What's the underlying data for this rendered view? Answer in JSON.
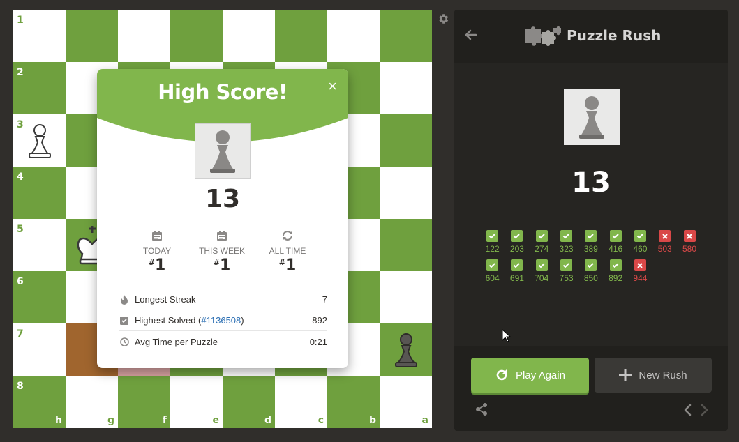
{
  "board": {
    "ranks": [
      "1",
      "2",
      "3",
      "4",
      "5",
      "6",
      "7",
      "8"
    ],
    "files": [
      "h",
      "g",
      "f",
      "e",
      "d",
      "c",
      "b",
      "a"
    ]
  },
  "modal": {
    "title": "High Score!",
    "close": "×",
    "score": "13",
    "ranks": [
      {
        "label": "TODAY",
        "prefix": "#",
        "value": "1"
      },
      {
        "label": "THIS WEEK",
        "prefix": "#",
        "value": "1"
      },
      {
        "label": "ALL TIME",
        "prefix": "#",
        "value": "1"
      }
    ],
    "stats": {
      "streak_label": "Longest Streak",
      "streak_value": "7",
      "highest_label": "Highest Solved (",
      "highest_link": "#1136508",
      "highest_close": ")",
      "highest_value": "892",
      "avg_label": "Avg Time per Puzzle",
      "avg_value": "0:21"
    }
  },
  "sidebar": {
    "title": "Puzzle Rush",
    "score": "13",
    "results_row1": [
      {
        "num": "122",
        "ok": true
      },
      {
        "num": "203",
        "ok": true
      },
      {
        "num": "274",
        "ok": true
      },
      {
        "num": "323",
        "ok": true
      },
      {
        "num": "389",
        "ok": true
      },
      {
        "num": "416",
        "ok": true
      },
      {
        "num": "460",
        "ok": true
      },
      {
        "num": "503",
        "ok": false
      },
      {
        "num": "580",
        "ok": false
      }
    ],
    "results_row2": [
      {
        "num": "604",
        "ok": true
      },
      {
        "num": "691",
        "ok": true
      },
      {
        "num": "704",
        "ok": true
      },
      {
        "num": "753",
        "ok": true
      },
      {
        "num": "850",
        "ok": true
      },
      {
        "num": "892",
        "ok": true
      },
      {
        "num": "944",
        "ok": false
      }
    ],
    "play_again": "Play Again",
    "new_rush": "New Rush"
  },
  "colors": {
    "board_dark": "#6fa03e",
    "board_light": "#ffffff",
    "accent_green": "#81b64c",
    "fail_red": "#d94848"
  }
}
